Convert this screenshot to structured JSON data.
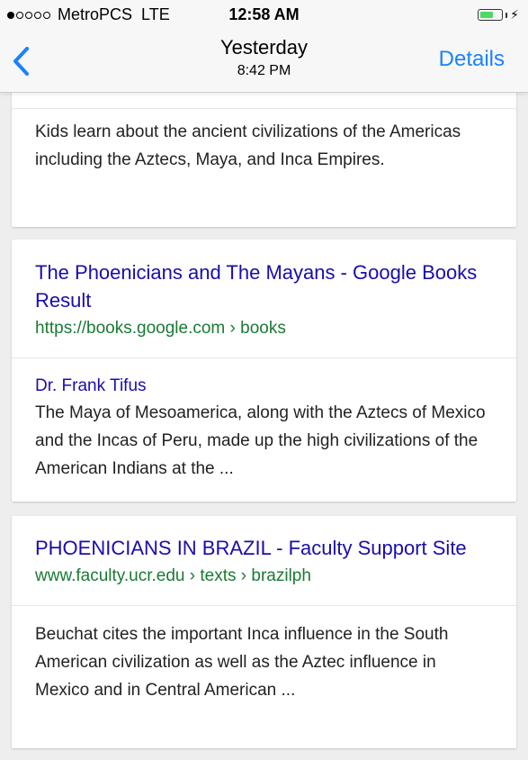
{
  "status_bar": {
    "carrier": "MetroPCS",
    "network": "LTE",
    "time": "12:58 AM",
    "signal_bars": 1
  },
  "nav": {
    "back_icon": "chevron-left-icon",
    "title": "Yesterday",
    "subtitle": "8:42 PM",
    "details_label": "Details",
    "accent_color": "#1a82fb"
  },
  "results": [
    {
      "snippet": "Kids learn about the ancient civilizations of the Americas including the Aztecs, Maya, and Inca Empires."
    },
    {
      "title": "The Phoenicians and The Mayans - Google Books Result",
      "url": "https://books.google.com › books",
      "author": "Dr. Frank Tifus",
      "snippet": "The Maya of Mesoamerica, along with the Aztecs of Mexico and the Incas of Peru, made up the high civilizations of the American Indians at the ..."
    },
    {
      "title": "PHOENICIANS IN BRAZIL - Faculty Support Site",
      "url": "www.faculty.ucr.edu › texts › brazilph",
      "snippet": "Beuchat cites the important Inca influence in the South American civilization as well as the Aztec influence in Mexico and in Central American ..."
    }
  ],
  "colors": {
    "link": "#1a0dab",
    "url": "#1a7a34",
    "text": "#222222"
  }
}
